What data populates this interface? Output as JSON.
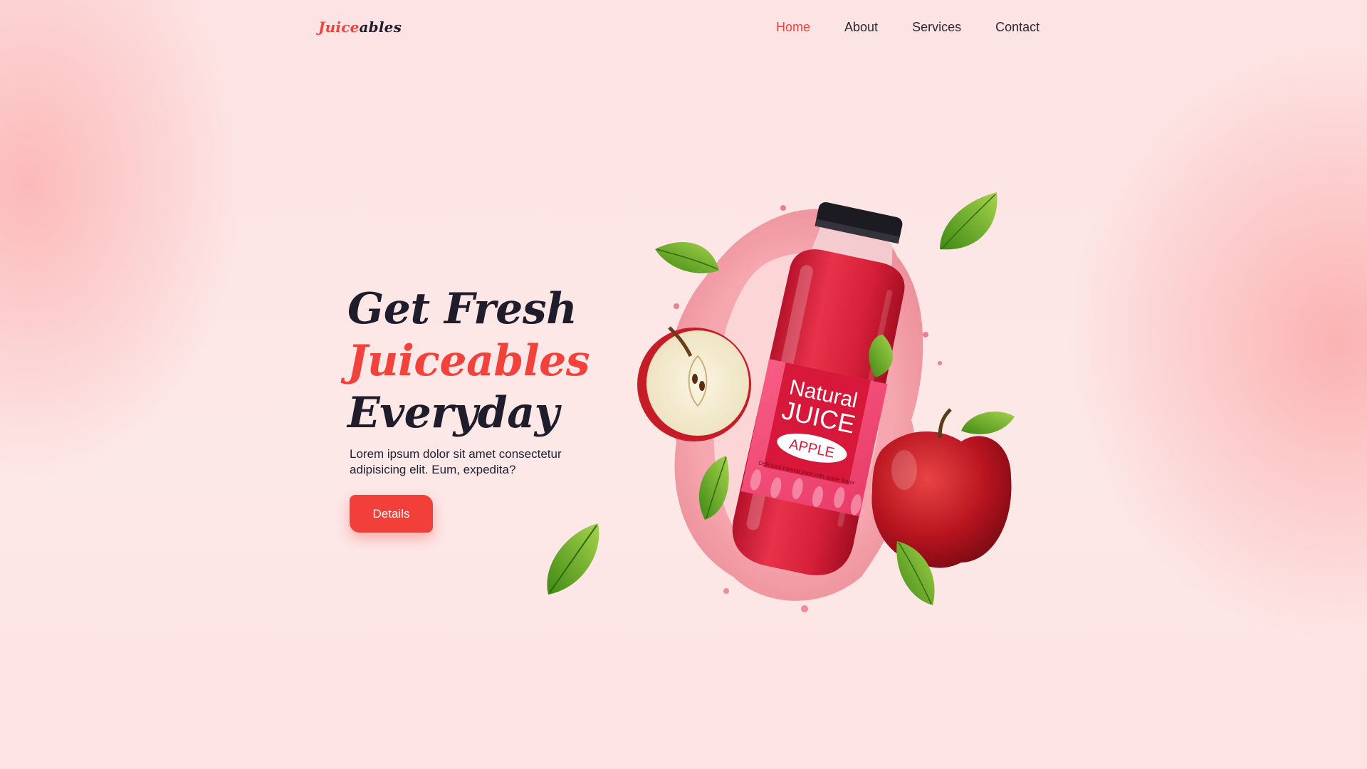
{
  "brand": {
    "part1": "Juice",
    "part2": "ables"
  },
  "nav": {
    "items": [
      {
        "label": "Home",
        "active": true
      },
      {
        "label": "About",
        "active": false
      },
      {
        "label": "Services",
        "active": false
      },
      {
        "label": "Contact",
        "active": false
      }
    ]
  },
  "hero": {
    "line1": "Get Fresh",
    "line2": "Juiceables",
    "line3": "Everyday",
    "description": "Lorem ipsum dolor sit amet consectetur adipisicing elit. Eum, expedita?",
    "button_label": "Details"
  },
  "product": {
    "label_line1": "Natural",
    "label_line2": "JUICE",
    "label_flavor": "APPLE",
    "label_small": "Delicious natural juice with apple flavor"
  },
  "colors": {
    "accent": "#f2423b",
    "text_dark": "#1f1c2c",
    "background": "#fde4e4"
  }
}
